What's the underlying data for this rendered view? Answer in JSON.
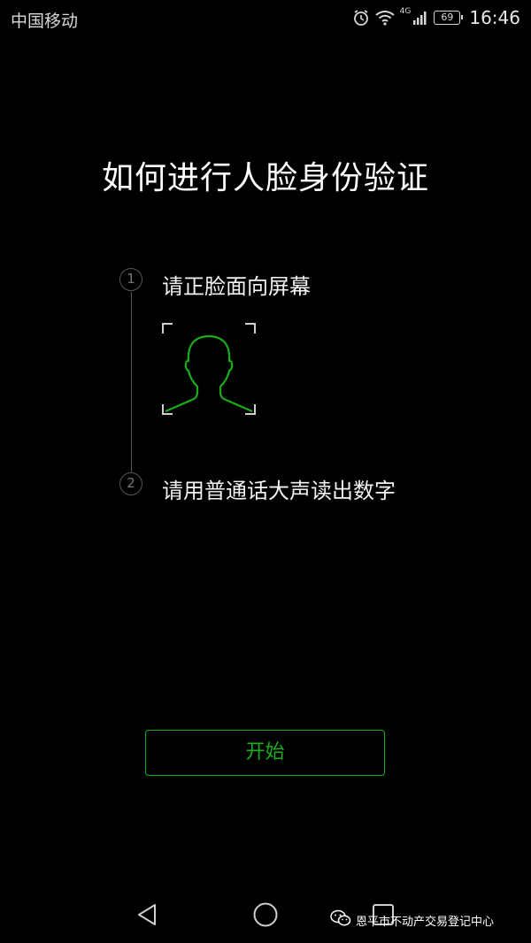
{
  "status_bar": {
    "carrier": "中国移动",
    "network": "4G",
    "battery": "69",
    "time": "16:46",
    "icons": [
      "alarm-icon",
      "wifi-icon",
      "signal-icon",
      "battery-icon"
    ]
  },
  "title": "如何进行人脸身份验证",
  "steps": [
    {
      "number": "1",
      "text": "请正脸面向屏幕"
    },
    {
      "number": "2",
      "text": "请用普通话大声读出数字"
    }
  ],
  "start_button": {
    "label": "开始"
  },
  "nav_bar": {
    "icons": [
      "back-triangle-icon",
      "home-circle-icon",
      "recent-square-icon"
    ]
  },
  "watermark": {
    "text": "恩平市不动产交易登记中心"
  },
  "colors": {
    "background": "#000000",
    "accent": "#1aad19",
    "text": "#ffffff",
    "muted": "#555555"
  }
}
